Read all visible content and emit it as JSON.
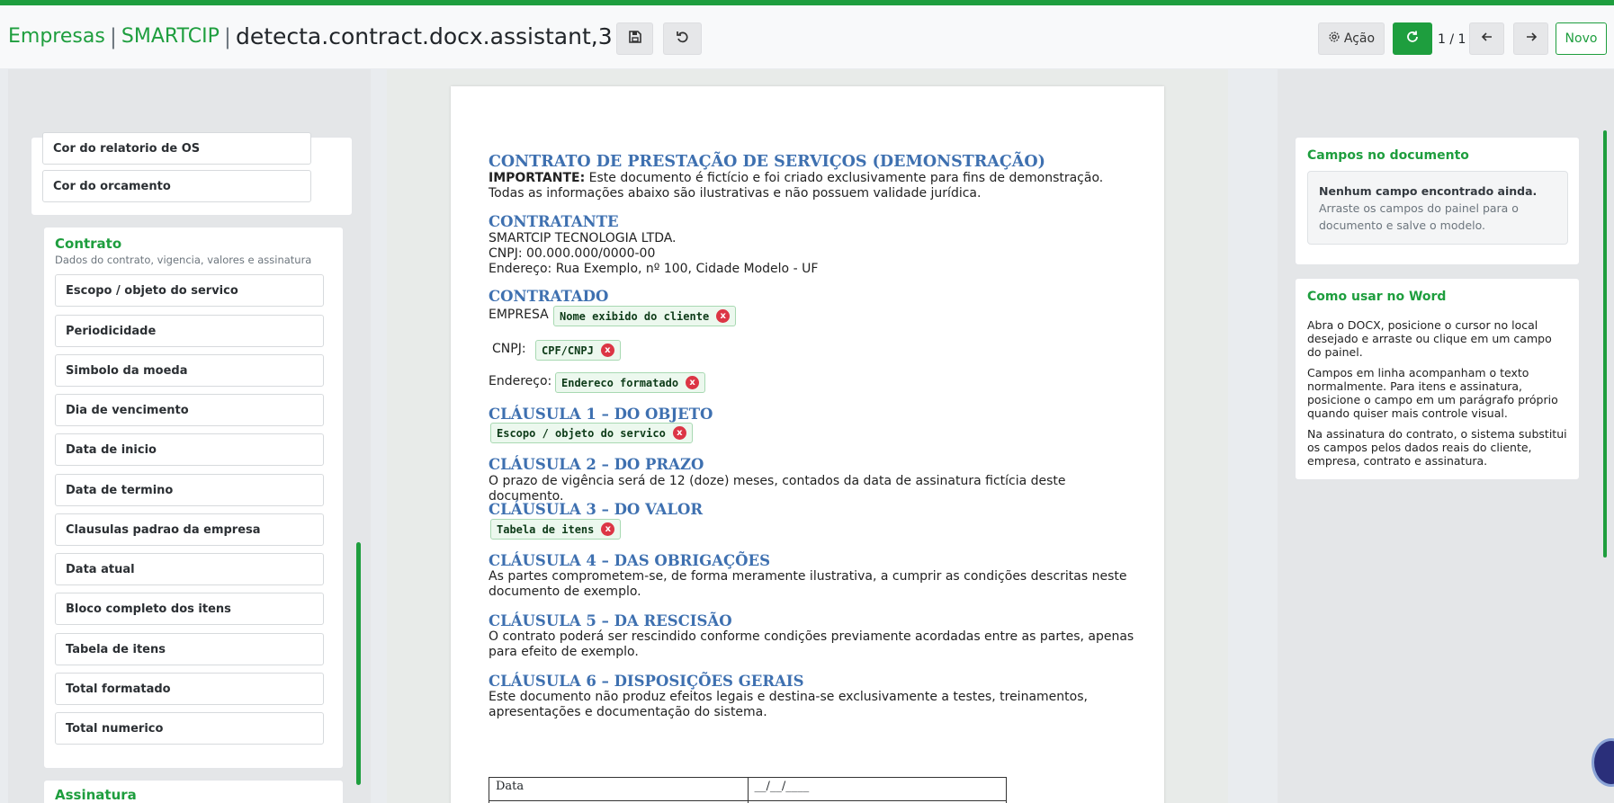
{
  "colors": {
    "accent": "#1e9e3e",
    "heading_blue": "#3e70b0",
    "danger": "#dc3545"
  },
  "header": {
    "breadcrumb": [
      "Empresas",
      "SMARTCIP"
    ],
    "separator": "|",
    "current": "detecta.contract.docx.assistant,3",
    "action_label": "Ação",
    "pager": "1 / 1",
    "new_label": "Novo",
    "icons": {
      "save": "floppy-disk-icon",
      "discard": "undo-icon",
      "action": "gear-icon",
      "refresh": "refresh-icon",
      "prev": "arrow-left-icon",
      "next": "arrow-right-icon"
    }
  },
  "left_panel": {
    "top_items": [
      "Cor do relatorio de OS",
      "Cor do orcamento"
    ],
    "contrato": {
      "title": "Contrato",
      "subtitle": "Dados do contrato, vigencia, valores e assinatura",
      "items": [
        "Escopo / objeto do servico",
        "Periodicidade",
        "Simbolo da moeda",
        "Dia de vencimento",
        "Data de inicio",
        "Data de termino",
        "Clausulas padrao da empresa",
        "Data atual",
        "Bloco completo dos itens",
        "Tabela de itens",
        "Total formatado",
        "Total numerico"
      ]
    },
    "next_section_title": "Assinatura"
  },
  "document": {
    "title": "CONTRATO DE PRESTAÇÃO DE SERVIÇOS (DEMONSTRAÇÃO)",
    "important_label": "IMPORTANTE:",
    "important_text": " Este documento é fictício e foi criado exclusivamente para fins de demonstração. Todas as informações abaixo são ilustrativas e não possuem validade jurídica.",
    "contratante": {
      "heading": "CONTRATANTE",
      "lines": [
        "SMARTCIP TECNOLOGIA LTDA.",
        "CNPJ: 00.000.000/0000-00",
        "Endereço: Rua Exemplo, nº 100, Cidade Modelo - UF"
      ]
    },
    "contratado": {
      "heading": "CONTRATADO",
      "empresa_label": "EMPRESA",
      "empresa_tag": "Nome exibido do cliente",
      "cnpj_label": "CNPJ:",
      "cnpj_tag": "CPF/CNPJ",
      "endereco_label": "Endereço:",
      "endereco_tag": "Endereco formatado"
    },
    "clausula1": {
      "heading": "CLÁUSULA 1 – DO OBJETO",
      "tag": "Escopo / objeto do servico"
    },
    "clausula2": {
      "heading": "CLÁUSULA 2 – DO PRAZO",
      "text": "O prazo de vigência será de 12 (doze) meses, contados da data de assinatura fictícia deste documento."
    },
    "clausula3": {
      "heading": "CLÁUSULA 3 – DO VALOR",
      "tag": "Tabela de itens"
    },
    "clausula4": {
      "heading": "CLÁUSULA 4 – DAS OBRIGAÇÕES",
      "text": "As partes comprometem-se, de forma meramente ilustrativa, a cumprir as condições descritas neste documento de exemplo."
    },
    "clausula5": {
      "heading": "CLÁUSULA 5 – DA RESCISÃO",
      "text": "O contrato poderá ser rescindido conforme condições previamente acordadas entre as partes, apenas para efeito de exemplo."
    },
    "clausula6": {
      "heading": "CLÁUSULA 6 – DISPOSIÇÕES GERAIS",
      "text": "Este documento não produz efeitos legais e destina-se exclusivamente a testes, treinamentos, apresentações e documentação do sistema."
    },
    "tag_remove": "x",
    "table": {
      "label": "Data",
      "value": "__/__/____"
    }
  },
  "right_panel": {
    "fields_title": "Campos no documento",
    "empty_title": "Nenhum campo encontrado ainda.",
    "empty_text": "Arraste os campos do painel para o documento e salve o modelo.",
    "howto_title": "Como usar no Word",
    "howto": [
      "Abra o DOCX, posicione o cursor no local desejado e arraste ou clique em um campo do painel.",
      "Campos em linha acompanham o texto normalmente. Para itens e assinatura, posicione o campo em um parágrafo próprio quando quiser mais controle visual.",
      "Na assinatura do contrato, o sistema substitui os campos pelos dados reais do cliente, empresa, contrato e assinatura."
    ]
  }
}
